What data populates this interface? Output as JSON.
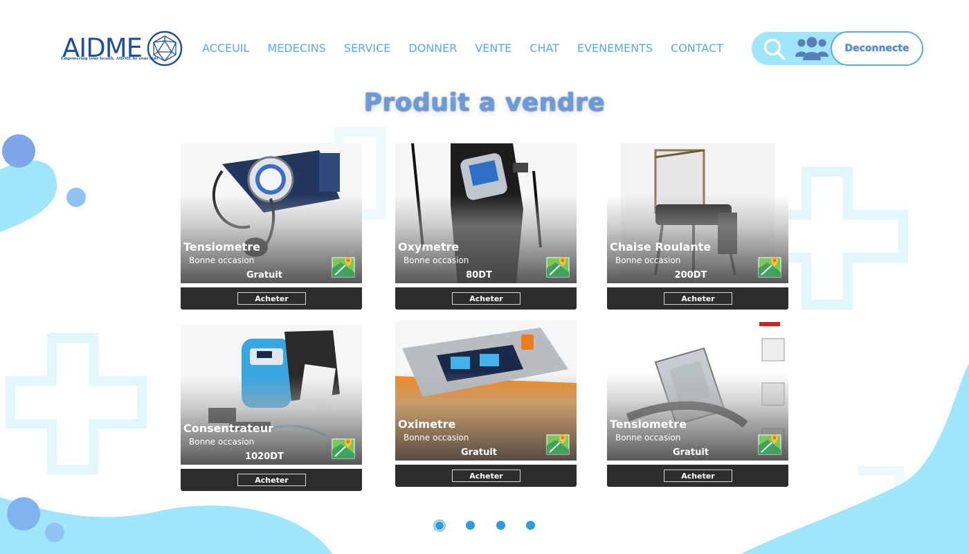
{
  "brand": {
    "name": "AIDME",
    "tagline": "Empowering your health, AIDME by your side",
    "brand_color": "#1d4f9a"
  },
  "nav": {
    "items": [
      {
        "label": "ACCEUIL"
      },
      {
        "label": "MEDECINS"
      },
      {
        "label": "SERVICE"
      },
      {
        "label": "DONNER"
      },
      {
        "label": "VENTE"
      },
      {
        "label": "CHAT"
      },
      {
        "label": "EVENEMENTS"
      },
      {
        "label": "CONTACT"
      }
    ],
    "color": "#5aa8e6"
  },
  "actions": {
    "search_icon": "search-icon",
    "users_icon": "users-icon",
    "logout_label": "Deconnecte",
    "pill_color": "#9fe5fb"
  },
  "page": {
    "title": "Produit a vendre"
  },
  "products": [
    {
      "name": "Tensiometre",
      "condition": "Bonne occasion",
      "price": "Gratuit",
      "buy_label": "Acheter",
      "image": "blood-pressure-cuff"
    },
    {
      "name": "Oxymetre",
      "condition": "Bonne occasion",
      "price": "80DT",
      "buy_label": "Acheter",
      "image": "pulse-oximeter-case"
    },
    {
      "name": "Chaise Roulante",
      "condition": "Bonne occasion",
      "price": "200DT",
      "buy_label": "Acheter",
      "image": "shower-wheelchair"
    },
    {
      "name": "Consentrateur",
      "condition": "Bonne occasion",
      "price": "1020DT",
      "buy_label": "Acheter",
      "image": "oxygen-concentrator"
    },
    {
      "name": "Oximetre",
      "condition": "Bonne occasion",
      "price": "Gratuit",
      "buy_label": "Acheter",
      "image": "finger-oximeter"
    },
    {
      "name": "Tensiometre",
      "condition": "Bonne occasion",
      "price": "Gratuit",
      "buy_label": "Acheter",
      "image": "wrist-bp-monitor"
    }
  ],
  "pagination": {
    "pages": 4,
    "current": 1
  }
}
